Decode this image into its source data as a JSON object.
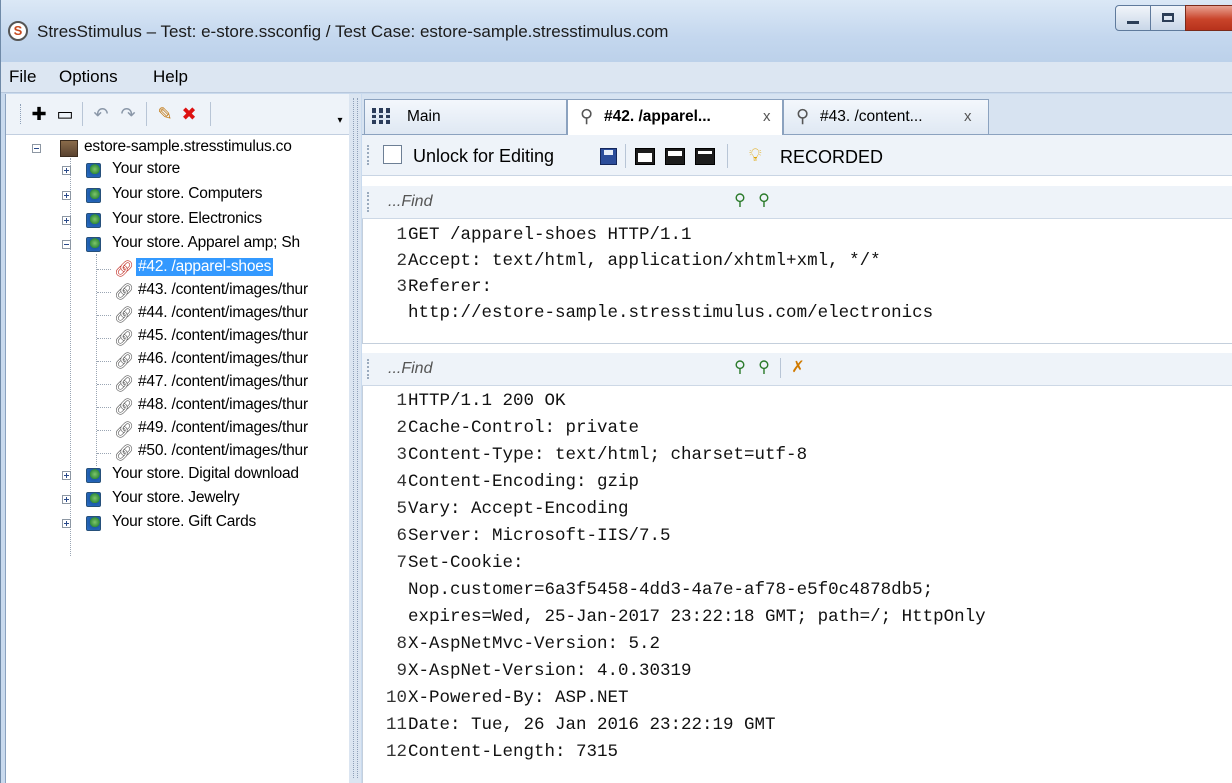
{
  "window": {
    "title": "StresStimulus – Test: e-store.ssconfig / Test Case: estore-sample.stresstimulus.com",
    "app_icon_letter": "S"
  },
  "menu": [
    "File",
    "Options",
    "Help"
  ],
  "toolbar_icons": [
    "add-icon",
    "collapse-icon",
    "undo-icon",
    "redo-icon",
    "edit-icon",
    "delete-icon"
  ],
  "tree": {
    "root": "estore-sample.stresstimulus.co",
    "items": [
      {
        "label": "Your store",
        "type": "page",
        "expanded": false
      },
      {
        "label": "Your store. Computers",
        "type": "page",
        "expanded": false
      },
      {
        "label": "Your store. Electronics",
        "type": "page",
        "expanded": false
      },
      {
        "label": "Your store. Apparel amp; Sh",
        "type": "page",
        "expanded": true
      },
      {
        "label": "#42. /apparel-shoes",
        "type": "request",
        "selected": true
      },
      {
        "label": "#43. /content/images/thur",
        "type": "request"
      },
      {
        "label": "#44. /content/images/thur",
        "type": "request"
      },
      {
        "label": "#45. /content/images/thur",
        "type": "request"
      },
      {
        "label": "#46. /content/images/thur",
        "type": "request"
      },
      {
        "label": "#47. /content/images/thur",
        "type": "request"
      },
      {
        "label": "#48. /content/images/thur",
        "type": "request"
      },
      {
        "label": "#49. /content/images/thur",
        "type": "request"
      },
      {
        "label": "#50. /content/images/thur",
        "type": "request"
      },
      {
        "label": "Your store. Digital download",
        "type": "page",
        "expanded": false
      },
      {
        "label": "Your store. Jewelry",
        "type": "page",
        "expanded": false
      },
      {
        "label": "Your store. Gift Cards",
        "type": "page",
        "expanded": false
      }
    ]
  },
  "tabs": [
    {
      "label": "Main",
      "closable": false
    },
    {
      "label": "#42. /apparel...",
      "closable": true,
      "active": true
    },
    {
      "label": "#43. /content...",
      "closable": true
    }
  ],
  "tab_close": "x",
  "request_toolbar": {
    "unlock_label": "Unlock for Editing",
    "status": "RECORDED"
  },
  "find_placeholder": "...Find",
  "request_lines": [
    {
      "n": "1",
      "text": "GET /apparel-shoes HTTP/1.1"
    },
    {
      "n": "2",
      "text": "Accept: text/html, application/xhtml+xml, */*"
    },
    {
      "n": "3",
      "text": "Referer:"
    },
    {
      "n": "",
      "text": "http://estore-sample.stresstimulus.com/electronics"
    }
  ],
  "response_lines": [
    {
      "n": "1",
      "text": "HTTP/1.1 200 OK"
    },
    {
      "n": "2",
      "text": "Cache-Control: private"
    },
    {
      "n": "3",
      "text": "Content-Type: text/html; charset=utf-8"
    },
    {
      "n": "4",
      "text": "Content-Encoding: gzip"
    },
    {
      "n": "5",
      "text": "Vary: Accept-Encoding"
    },
    {
      "n": "6",
      "text": "Server: Microsoft-IIS/7.5"
    },
    {
      "n": "7",
      "text": "Set-Cookie:"
    },
    {
      "n": "",
      "text": "Nop.customer=6a3f5458-4dd3-4a7e-af78-e5f0c4878db5;"
    },
    {
      "n": "",
      "text": "expires=Wed, 25-Jan-2017 23:22:18 GMT; path=/; HttpOnly"
    },
    {
      "n": "8",
      "text": "X-AspNetMvc-Version: 5.2"
    },
    {
      "n": "9",
      "text": "X-AspNet-Version: 4.0.30319"
    },
    {
      "n": "10",
      "text": "X-Powered-By: ASP.NET"
    },
    {
      "n": "11",
      "text": "Date: Tue, 26 Jan 2016 23:22:19 GMT"
    },
    {
      "n": "12",
      "text": "Content-Length: 7315"
    }
  ]
}
